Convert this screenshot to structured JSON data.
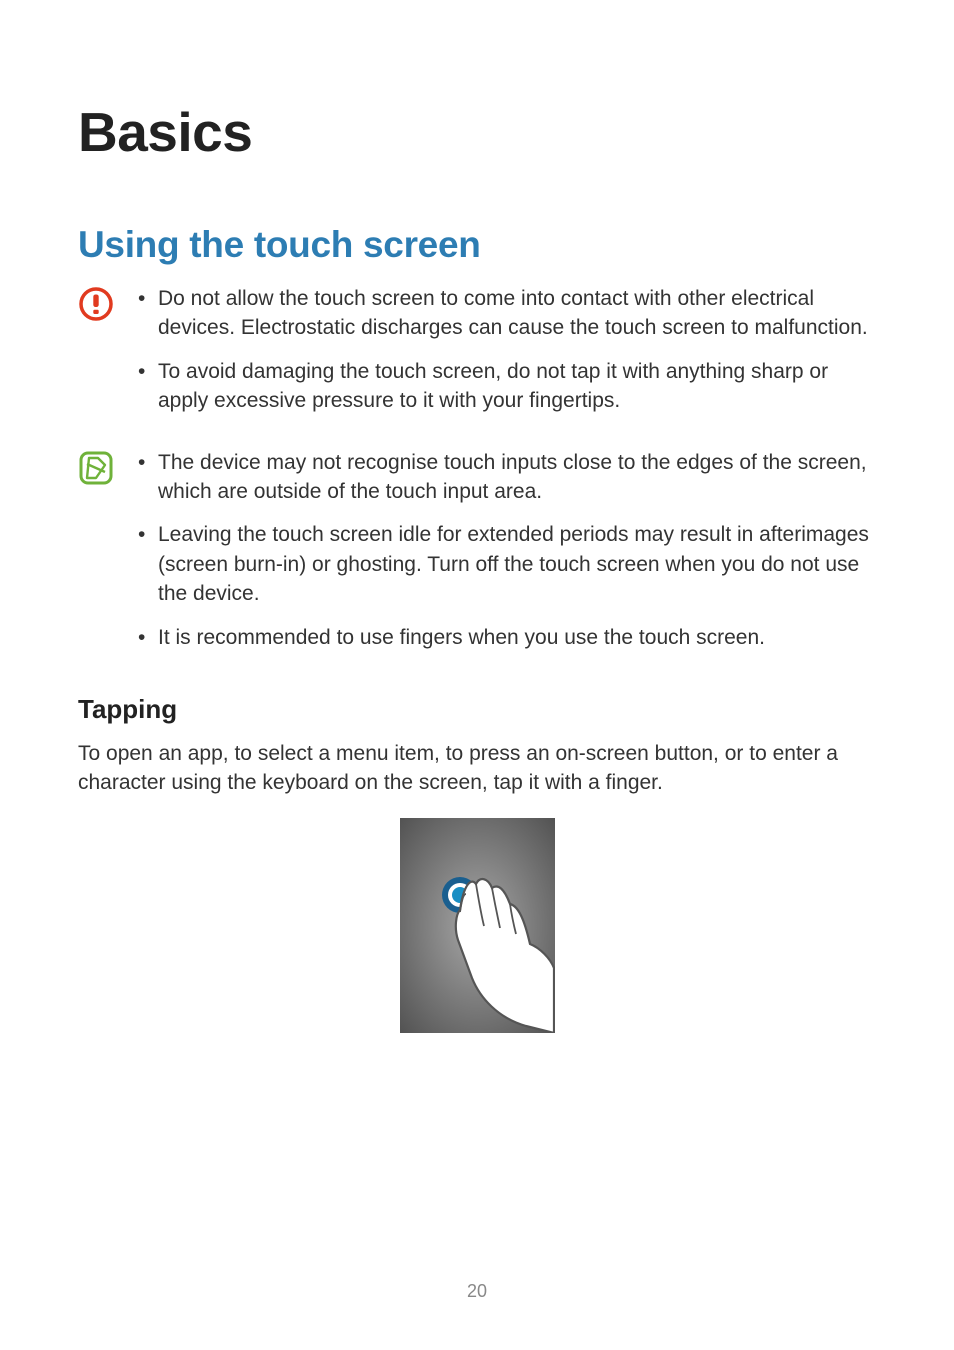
{
  "chapter_title": "Basics",
  "section_title": "Using the touch screen",
  "caution_items": [
    "Do not allow the touch screen to come into contact with other electrical devices. Electrostatic discharges can cause the touch screen to malfunction.",
    "To avoid damaging the touch screen, do not tap it with anything sharp or apply excessive pressure to it with your fingertips."
  ],
  "note_items": [
    "The device may not recognise touch inputs close to the edges of the screen, which are outside of the touch input area.",
    "Leaving the touch screen idle for extended periods may result in afterimages (screen burn-in) or ghosting. Turn off the touch screen when you do not use the device.",
    "It is recommended to use fingers when you use the touch screen."
  ],
  "subsection_title": "Tapping",
  "subsection_body": "To open an app, to select a menu item, to press an on-screen button, or to enter a character using the keyboard on the screen, tap it with a finger.",
  "page_number": "20"
}
